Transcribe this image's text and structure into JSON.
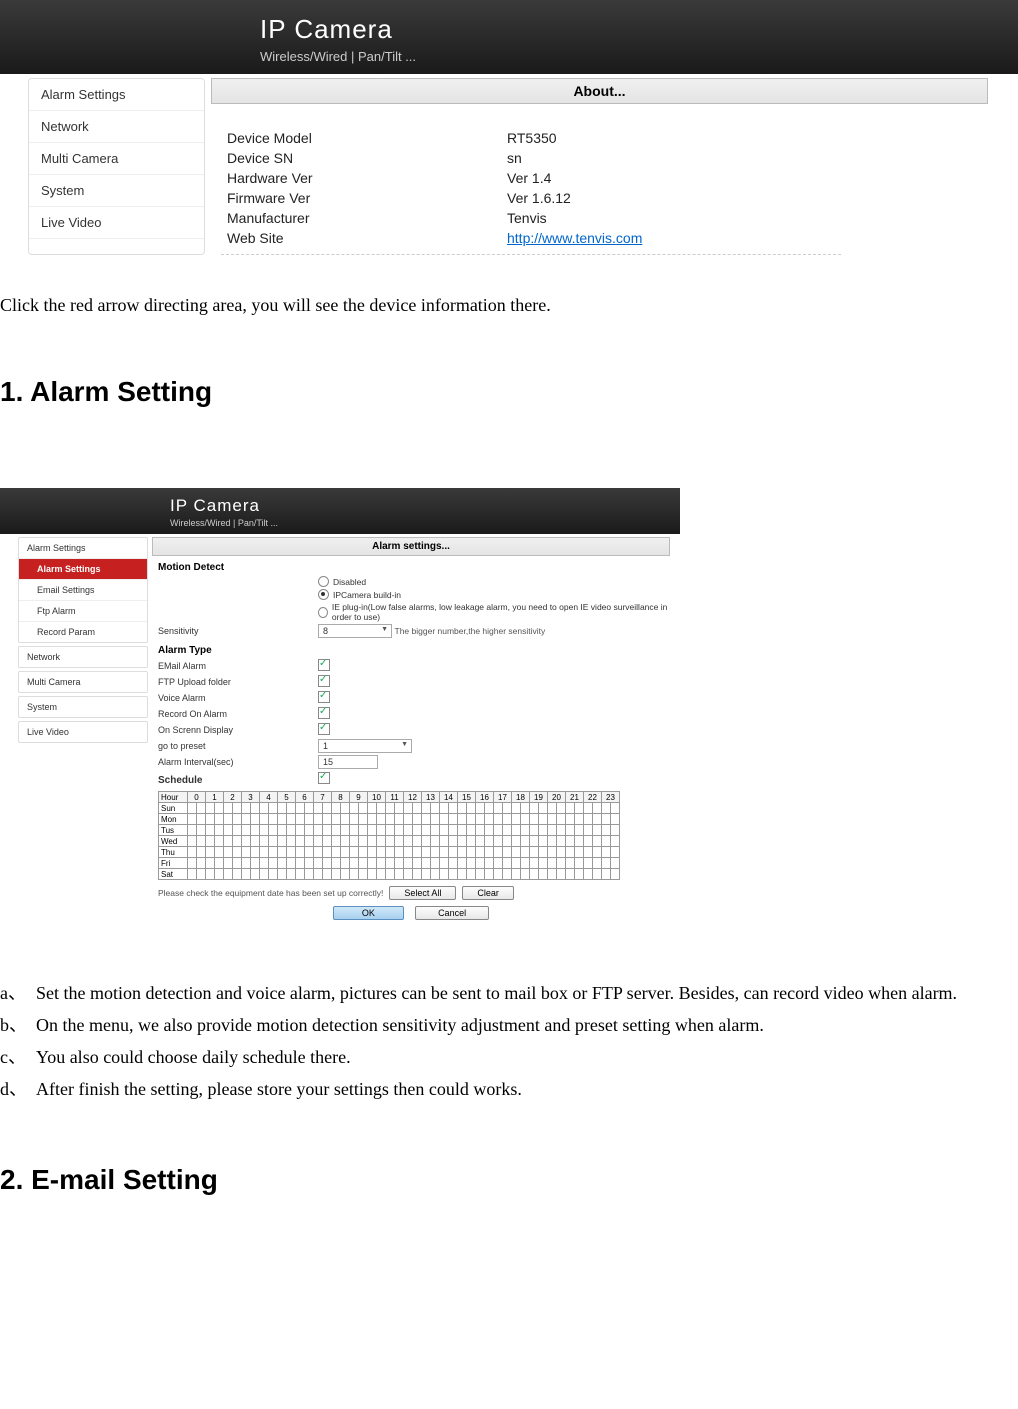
{
  "screenshot1": {
    "header_title": "IP Camera",
    "header_sub": "Wireless/Wired  |  Pan/Tilt  ...",
    "sidebar": [
      "Alarm Settings",
      "Network",
      "Multi Camera",
      "System",
      "Live Video"
    ],
    "panel_title": "About...",
    "rows": [
      {
        "label": "Device Model",
        "value": "RT5350"
      },
      {
        "label": "Device SN",
        "value": "sn"
      },
      {
        "label": "Hardware Ver",
        "value": "Ver 1.4"
      },
      {
        "label": "Firmware Ver",
        "value": "Ver 1.6.12"
      },
      {
        "label": "Manufacturer",
        "value": "Tenvis"
      },
      {
        "label": "Web Site",
        "value": "http://www.tenvis.com",
        "link": true
      }
    ]
  },
  "doc": {
    "intro": "Click the red arrow directing area, you will see the device information there.",
    "h1": "1. Alarm Setting",
    "list": [
      {
        "marker": "a、",
        "text": "Set the motion detection and voice alarm, pictures can be sent to mail box or FTP server. Besides, can record video when alarm."
      },
      {
        "marker": "b、",
        "text": "On the menu, we also provide motion detection sensitivity adjustment and preset setting when alarm."
      },
      {
        "marker": "c、",
        "text": "You also could choose daily schedule there."
      },
      {
        "marker": "d、",
        "text": " After finish the setting, please store your settings then could works."
      }
    ],
    "h2": "2. E-mail Setting"
  },
  "screenshot2": {
    "header_title": "IP Camera",
    "header_sub": "Wireless/Wired  |  Pan/Tilt  ...",
    "sidebar_top": "Alarm Settings",
    "sidebar_sub": [
      "Alarm Settings",
      "Email Settings",
      "Ftp Alarm",
      "Record Param"
    ],
    "sidebar_rest": [
      "Network",
      "Multi Camera",
      "System",
      "Live Video"
    ],
    "panel_title": "Alarm settings...",
    "motion_detect_title": "Motion Detect",
    "radios": [
      {
        "label": "Disabled",
        "checked": false
      },
      {
        "label": "IPCamera build-in",
        "checked": true
      },
      {
        "label": "IE plug-in(Low false alarms, low leakage alarm, you need to open IE video surveillance in order to use)",
        "checked": false
      }
    ],
    "sensitivity_label": "Sensitivity",
    "sensitivity_value": "8",
    "sensitivity_hint": "The bigger number,the higher sensitivity",
    "alarm_type_title": "Alarm Type",
    "alarm_rows": [
      {
        "label": "EMail Alarm",
        "checked": true
      },
      {
        "label": "FTP Upload folder",
        "checked": true
      },
      {
        "label": "Voice Alarm",
        "checked": true
      },
      {
        "label": "Record On Alarm",
        "checked": true
      },
      {
        "label": "On Screnn Display",
        "checked": true
      }
    ],
    "preset_label": "go to preset",
    "preset_value": "1",
    "interval_label": "Alarm Interval(sec)",
    "interval_value": "15",
    "schedule_title": "Schedule",
    "schedule_hours_label": "Hour",
    "schedule_hours": [
      "0",
      "1",
      "2",
      "3",
      "4",
      "5",
      "6",
      "7",
      "8",
      "9",
      "10",
      "11",
      "12",
      "13",
      "14",
      "15",
      "16",
      "17",
      "18",
      "19",
      "20",
      "21",
      "22",
      "23"
    ],
    "schedule_days": [
      "Sun",
      "Mon",
      "Tus",
      "Wed",
      "Thu",
      "Fri",
      "Sat"
    ],
    "check_date_text": "Please check the equipment date has been set up correctly!",
    "btn_select_all": "Select All",
    "btn_clear": "Clear",
    "btn_ok": "OK",
    "btn_cancel": "Cancel"
  }
}
